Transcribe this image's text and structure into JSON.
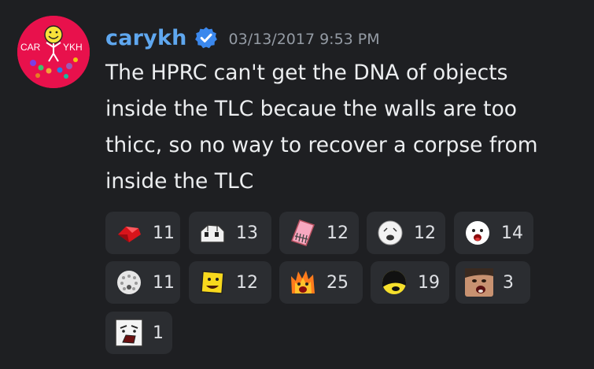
{
  "message": {
    "author": "carykh",
    "timestamp": "03/13/2017 9:53 PM",
    "lines": [
      "The HPRC can't get the DNA of objects",
      "inside the TLC becaue the walls are too",
      "thicc, so no way to recover a corpse from",
      "inside the TLC"
    ],
    "avatar": {
      "text_left": "CAR",
      "text_right": "YKH",
      "background": "#e8114c"
    },
    "verified_icon": "verified-check-badge"
  },
  "reactions": [
    {
      "emoji": "ruby-emoji",
      "count": "11"
    },
    {
      "emoji": "bracelety-house-emoji",
      "count": "13"
    },
    {
      "emoji": "eraser-emoji",
      "count": "12"
    },
    {
      "emoji": "golf-ball-emoji",
      "count": "12"
    },
    {
      "emoji": "snowball-screaming-emoji",
      "count": "14"
    },
    {
      "emoji": "golf-ball-holes-emoji",
      "count": "11"
    },
    {
      "emoji": "yellow-face-emoji",
      "count": "12"
    },
    {
      "emoji": "firey-emoji",
      "count": "25"
    },
    {
      "emoji": "black-hair-emoji",
      "count": "19"
    },
    {
      "emoji": "screaming-man-emoji",
      "count": "3"
    },
    {
      "emoji": "crying-face-emoji",
      "count": "1"
    }
  ],
  "colors": {
    "background": "#1e1f22",
    "username": "#5fa7ef",
    "timestamp": "#949ba4",
    "reaction_bg": "#2b2d31",
    "verified": "#3b88ed"
  }
}
